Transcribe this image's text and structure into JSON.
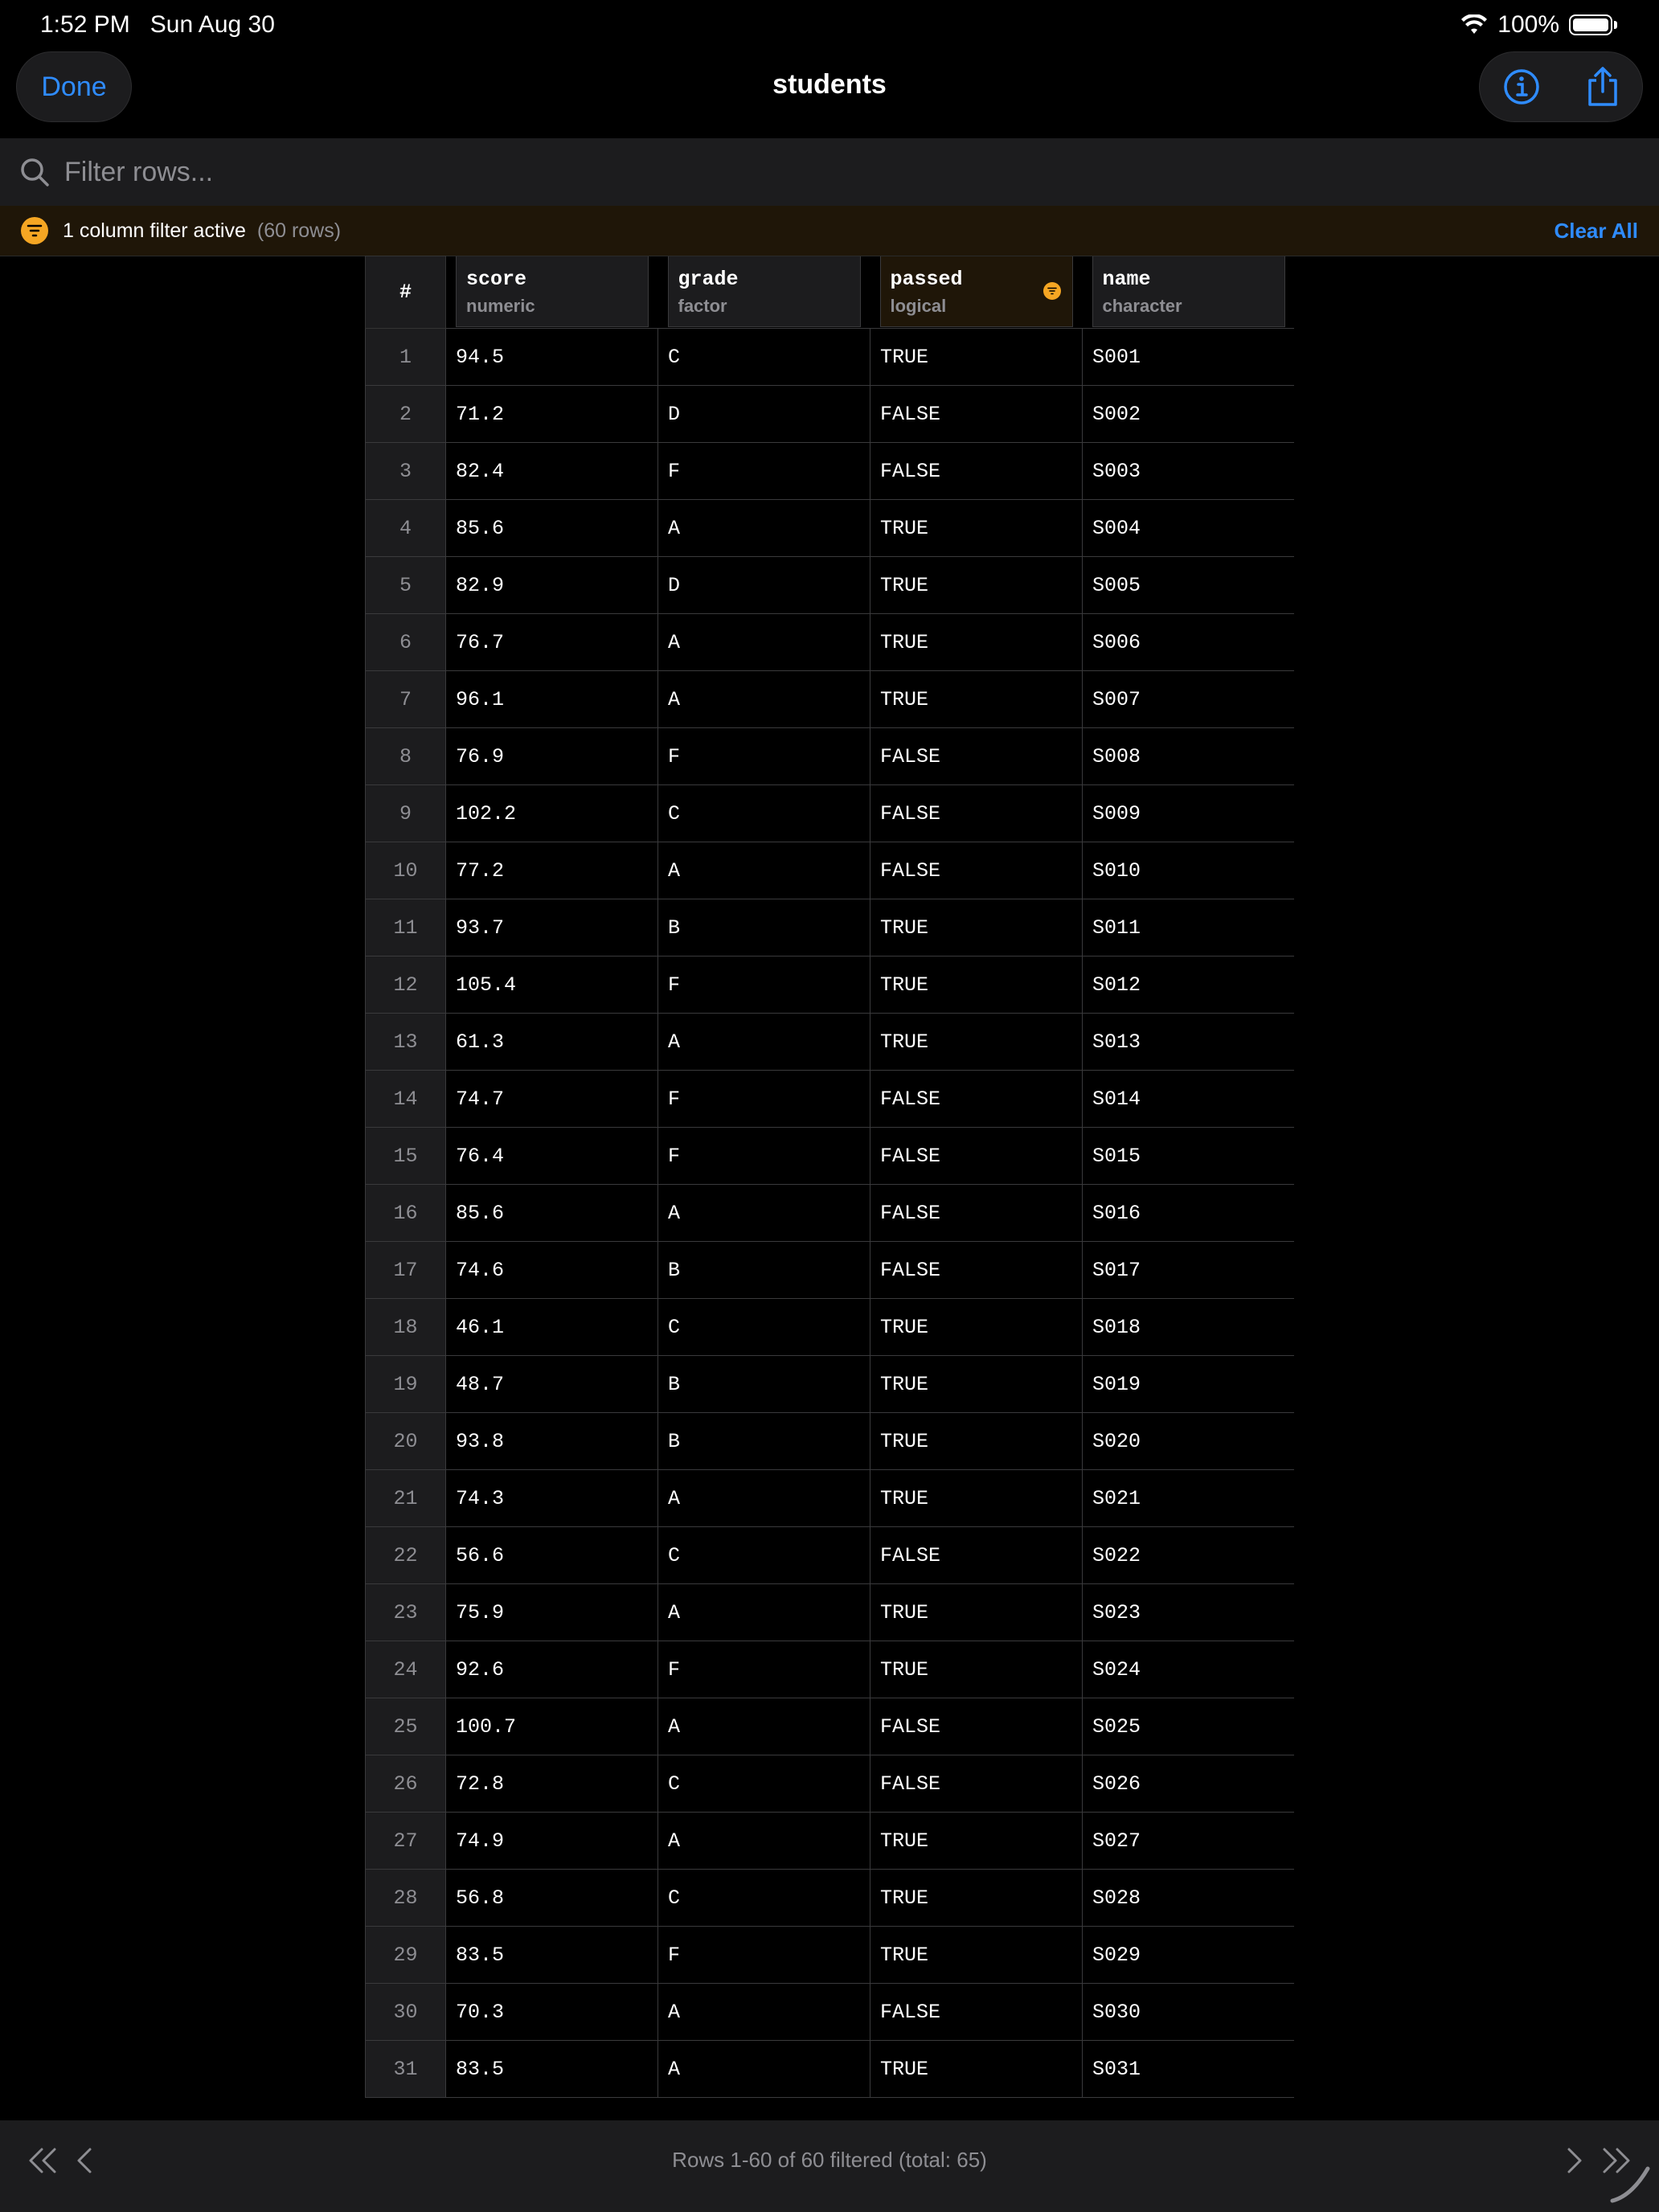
{
  "status": {
    "time": "1:52 PM",
    "date": "Sun Aug 30",
    "battery": "100%"
  },
  "nav": {
    "done_label": "Done",
    "title": "students"
  },
  "search": {
    "placeholder": "Filter rows..."
  },
  "filter_banner": {
    "text": "1 column filter active",
    "count": "(60 rows)",
    "clear_label": "Clear All"
  },
  "table": {
    "rownum_header": "#",
    "columns": [
      {
        "name": "score",
        "type": "numeric"
      },
      {
        "name": "grade",
        "type": "factor"
      },
      {
        "name": "passed",
        "type": "logical"
      },
      {
        "name": "name",
        "type": "character"
      }
    ],
    "rows": [
      [
        "1",
        "94.5",
        "C",
        "TRUE",
        "S001"
      ],
      [
        "2",
        "71.2",
        "D",
        "FALSE",
        "S002"
      ],
      [
        "3",
        "82.4",
        "F",
        "FALSE",
        "S003"
      ],
      [
        "4",
        "85.6",
        "A",
        "TRUE",
        "S004"
      ],
      [
        "5",
        "82.9",
        "D",
        "TRUE",
        "S005"
      ],
      [
        "6",
        "76.7",
        "A",
        "TRUE",
        "S006"
      ],
      [
        "7",
        "96.1",
        "A",
        "TRUE",
        "S007"
      ],
      [
        "8",
        "76.9",
        "F",
        "FALSE",
        "S008"
      ],
      [
        "9",
        "102.2",
        "C",
        "FALSE",
        "S009"
      ],
      [
        "10",
        "77.2",
        "A",
        "FALSE",
        "S010"
      ],
      [
        "11",
        "93.7",
        "B",
        "TRUE",
        "S011"
      ],
      [
        "12",
        "105.4",
        "F",
        "TRUE",
        "S012"
      ],
      [
        "13",
        "61.3",
        "A",
        "TRUE",
        "S013"
      ],
      [
        "14",
        "74.7",
        "F",
        "FALSE",
        "S014"
      ],
      [
        "15",
        "76.4",
        "F",
        "FALSE",
        "S015"
      ],
      [
        "16",
        "85.6",
        "A",
        "FALSE",
        "S016"
      ],
      [
        "17",
        "74.6",
        "B",
        "FALSE",
        "S017"
      ],
      [
        "18",
        "46.1",
        "C",
        "TRUE",
        "S018"
      ],
      [
        "19",
        "48.7",
        "B",
        "TRUE",
        "S019"
      ],
      [
        "20",
        "93.8",
        "B",
        "TRUE",
        "S020"
      ],
      [
        "21",
        "74.3",
        "A",
        "TRUE",
        "S021"
      ],
      [
        "22",
        "56.6",
        "C",
        "FALSE",
        "S022"
      ],
      [
        "23",
        "75.9",
        "A",
        "TRUE",
        "S023"
      ],
      [
        "24",
        "92.6",
        "F",
        "TRUE",
        "S024"
      ],
      [
        "25",
        "100.7",
        "A",
        "FALSE",
        "S025"
      ],
      [
        "26",
        "72.8",
        "C",
        "FALSE",
        "S026"
      ],
      [
        "27",
        "74.9",
        "A",
        "TRUE",
        "S027"
      ],
      [
        "28",
        "56.8",
        "C",
        "TRUE",
        "S028"
      ],
      [
        "29",
        "83.5",
        "F",
        "TRUE",
        "S029"
      ],
      [
        "30",
        "70.3",
        "A",
        "FALSE",
        "S030"
      ],
      [
        "31",
        "83.5",
        "A",
        "TRUE",
        "S031"
      ]
    ]
  },
  "footer": {
    "text": "Rows 1-60 of 60 filtered (total: 65)"
  },
  "colors": {
    "accent": "#2f8cff",
    "filter": "#f5a623",
    "background": "#000000",
    "surface": "#1c1c1e"
  }
}
